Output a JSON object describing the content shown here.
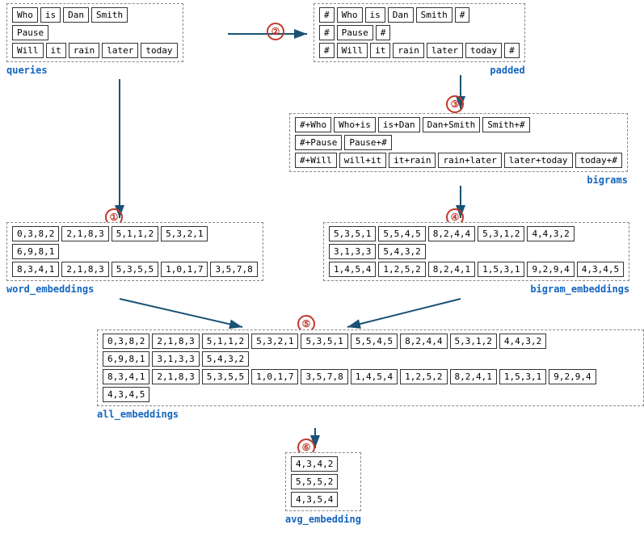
{
  "labels": {
    "queries": "queries",
    "padded": "padded",
    "bigrams": "bigrams",
    "word_embeddings": "word_embeddings",
    "bigram_embeddings": "bigram_embeddings",
    "all_embeddings": "all_embeddings",
    "avg_embedding": "avg_embedding"
  },
  "queries": {
    "rows": [
      [
        "Who",
        "is",
        "Dan",
        "Smith"
      ],
      [
        "Pause"
      ],
      [
        "Will",
        "it",
        "rain",
        "later",
        "today"
      ]
    ]
  },
  "padded": {
    "rows": [
      [
        "#",
        "Who",
        "is",
        "Dan",
        "Smith",
        "#"
      ],
      [
        "#",
        "Pause",
        "#"
      ],
      [
        "#",
        "Will",
        "it",
        "rain",
        "later",
        "today",
        "#"
      ]
    ]
  },
  "bigrams": {
    "rows": [
      [
        "#+Who",
        "Who+is",
        "is+Dan",
        "Dan+Smith",
        "Smith+#"
      ],
      [
        "#+Pause",
        "Pause+#"
      ],
      [
        "#+Will",
        "will+it",
        "it+rain",
        "rain+later",
        "later+today",
        "today+#"
      ]
    ]
  },
  "word_embeddings": {
    "rows": [
      [
        "0,3,8,2",
        "2,1,8,3",
        "5,1,1,2",
        "5,3,2,1"
      ],
      [
        "6,9,8,1"
      ],
      [
        "8,3,4,1",
        "2,1,8,3",
        "5,3,5,5",
        "1,0,1,7",
        "3,5,7,8"
      ]
    ]
  },
  "bigram_embeddings": {
    "rows": [
      [
        "5,3,5,1",
        "5,5,4,5",
        "8,2,4,4",
        "5,3,1,2",
        "4,4,3,2"
      ],
      [
        "3,1,3,3",
        "5,4,3,2"
      ],
      [
        "1,4,5,4",
        "1,2,5,2",
        "8,2,4,1",
        "1,5,3,1",
        "9,2,9,4",
        "4,3,4,5"
      ]
    ]
  },
  "all_embeddings": {
    "rows": [
      [
        "0,3,8,2",
        "2,1,8,3",
        "5,1,1,2",
        "5,3,2,1",
        "5,3,5,1",
        "5,5,4,5",
        "8,2,4,4",
        "5,3,1,2",
        "4,4,3,2"
      ],
      [
        "6,9,8,1",
        "3,1,3,3",
        "5,4,3,2"
      ],
      [
        "8,3,4,1",
        "2,1,8,3",
        "5,3,5,5",
        "1,0,1,7",
        "3,5,7,8",
        "1,4,5,4",
        "1,2,5,2",
        "8,2,4,1",
        "1,5,3,1",
        "9,2,9,4",
        "4,3,4,5"
      ]
    ]
  },
  "avg_embedding": {
    "rows": [
      [
        "4,3,4,2"
      ],
      [
        "5,5,5,2"
      ],
      [
        "4,3,5,4"
      ]
    ]
  },
  "steps": [
    "①",
    "②",
    "③",
    "④",
    "⑤",
    "⑥"
  ]
}
